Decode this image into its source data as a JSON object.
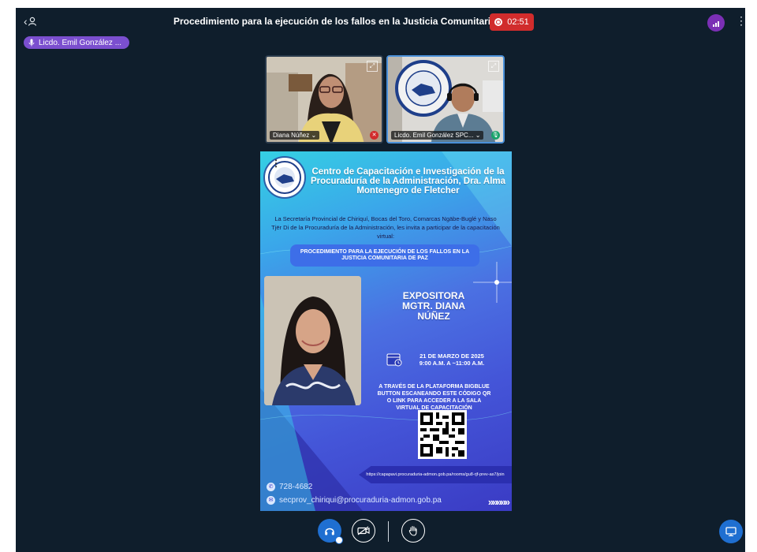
{
  "meeting": {
    "title": "Procedimiento para la ejecución de los fallos en la Justicia Comunitaria de Paz",
    "recording_time": "02:51",
    "talking_indicator": "Licdo. Emil González ..."
  },
  "icons": {
    "user_list": "‹",
    "kebab": "⋮",
    "expand": "⤢",
    "mic": "🎙",
    "muted": "✕",
    "headphones": "🎧",
    "camera_off": "⊘",
    "hand": "✋",
    "present": "▭",
    "phone": "✆",
    "email": "✉"
  },
  "videos": [
    {
      "label": "Diana Núñez ⌄"
    },
    {
      "label": "Licdo. Emil González SPC... ⌄"
    }
  ],
  "slide": {
    "title": "Centro de Capacitación e Investigación de la Procuraduría de la Administración, Dra. Alma Montenegro de Fletcher",
    "intro": "La Secretaría Provincial de Chiriquí, Bocas del Toro, Comarcas Ngäbe-Buglé y Naso Tjër Di de la Procuraduría de la Administración, les invita a participar de la capacitación virtual:",
    "course": "PROCEDIMIENTO PARA LA EJECUCIÓN DE LOS FALLOS EN LA JUSTICIA COMUNITARIA DE PAZ",
    "expositora_line1": "EXPOSITORA",
    "expositora_line2": "MGTR. DIANA",
    "expositora_line3": "NÚÑEZ",
    "date_line1": "21 DE MARZO DE 2025",
    "date_line2": "9:00 A.M. A ~11:00 A.M.",
    "platform": "A TRAVÉS DE LA PLATAFORMA BIGBLUE BUTTON ESCANEANDO ESTE CÓDIGO QR O LINK PARA ACCEDER A LA SALA VIRTUAL DE CAPACITACIÓN",
    "link": "https://capapavi.procuraduria-admon.gob.pa/rooms/gu8-rjf-prev-as7/join",
    "phone": "728-4682",
    "email": "secprov_chiriqui@procuraduria-admon.gob.pa",
    "chevrons": "»»»»»"
  },
  "colors": {
    "app_bg": "#0f1e2c",
    "recording": "#d12c2c",
    "primary": "#1f6fd1",
    "talker": "#7b4fcf",
    "connection": "#7b2fb5"
  }
}
